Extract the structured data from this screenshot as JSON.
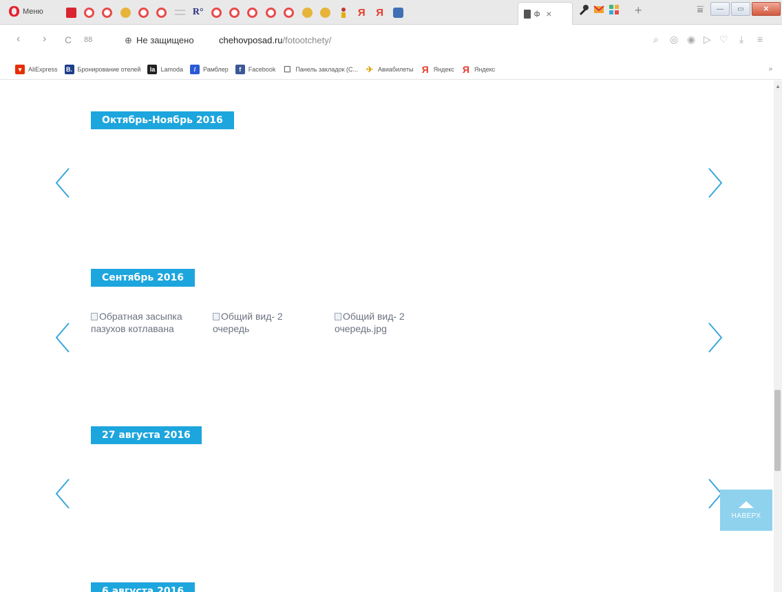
{
  "browser": {
    "menu_label": "Меню",
    "menu_logo": "O",
    "active_tab_title": "ф",
    "tab_close": "×",
    "new_tab": "+",
    "ya_letter": "Я",
    "r_letter": "R°",
    "window_buttons": [
      "—",
      "▭",
      "✕"
    ]
  },
  "address_bar": {
    "back": "‹",
    "forward": "›",
    "reload": "C",
    "speed_dial": "88",
    "security_icon": "⊕",
    "security_text": "Не защищено",
    "host": "chehovposad.ru",
    "path": "/fotootchety/"
  },
  "bookmarks": [
    {
      "label": "AliExpress",
      "color": "#e62e04",
      "glyph": "▾"
    },
    {
      "label": "Бронирование отелей",
      "color": "#1d3e8a",
      "glyph": "B."
    },
    {
      "label": "Lamoda",
      "color": "#222222",
      "glyph": "la"
    },
    {
      "label": "Рамблер",
      "color": "#2a5bd7",
      "glyph": "/"
    },
    {
      "label": "Facebook",
      "color": "#3b5998",
      "glyph": "f"
    },
    {
      "label": "Панель закладок (С...",
      "color": "transparent",
      "glyph": "☐"
    },
    {
      "label": "Авиабилеты",
      "color": "transparent",
      "glyph": "✈"
    },
    {
      "label": "Яндекс",
      "color": "transparent",
      "glyph": "Я"
    },
    {
      "label": "Яндекс",
      "color": "transparent",
      "glyph": "Я"
    }
  ],
  "bookmarks_more": "»",
  "sections": [
    {
      "label": "Октябрь-Ноябрь 2016"
    },
    {
      "label": "Сентябрь 2016"
    },
    {
      "label": "27 августа 2016"
    },
    {
      "label": "6 августа 2016"
    }
  ],
  "september_images": [
    {
      "alt": "Обратная засыпка пазухов котлавана"
    },
    {
      "alt": "Общий вид- 2 очередь"
    },
    {
      "alt": "Общий вид- 2 очередь.jpg"
    }
  ],
  "to_top_label": "НАВЕРХ",
  "colors": {
    "accent": "#1da5dd",
    "arrow": "#3aa6dc",
    "to_top": "#8fd2ee"
  }
}
